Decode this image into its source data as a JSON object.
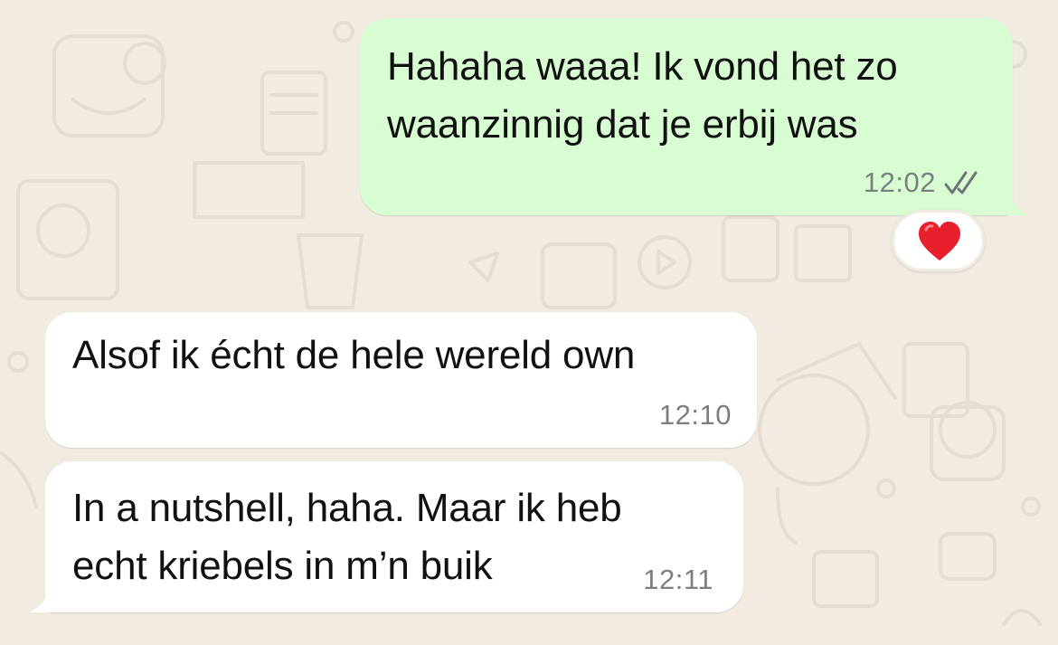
{
  "messages": [
    {
      "direction": "outgoing",
      "text": "Hahaha waaa! Ik vond het zo\nwaanzinnig dat je erbij was",
      "time": "12:02",
      "status_icon": "double-check-icon",
      "reaction": "red-heart-icon"
    },
    {
      "direction": "incoming",
      "text": "Alsof ik écht de hele wereld own",
      "time": "12:10"
    },
    {
      "direction": "incoming",
      "text": "In a nutshell, haha. Maar ik heb\necht kriebels in m’n buik",
      "time": "12:11"
    }
  ],
  "colors": {
    "background": "#f1ebe2",
    "outgoing_bubble": "#d9fdd3",
    "incoming_bubble": "#ffffff",
    "timestamp": "#7b7f82",
    "heart": "#e8202d"
  }
}
